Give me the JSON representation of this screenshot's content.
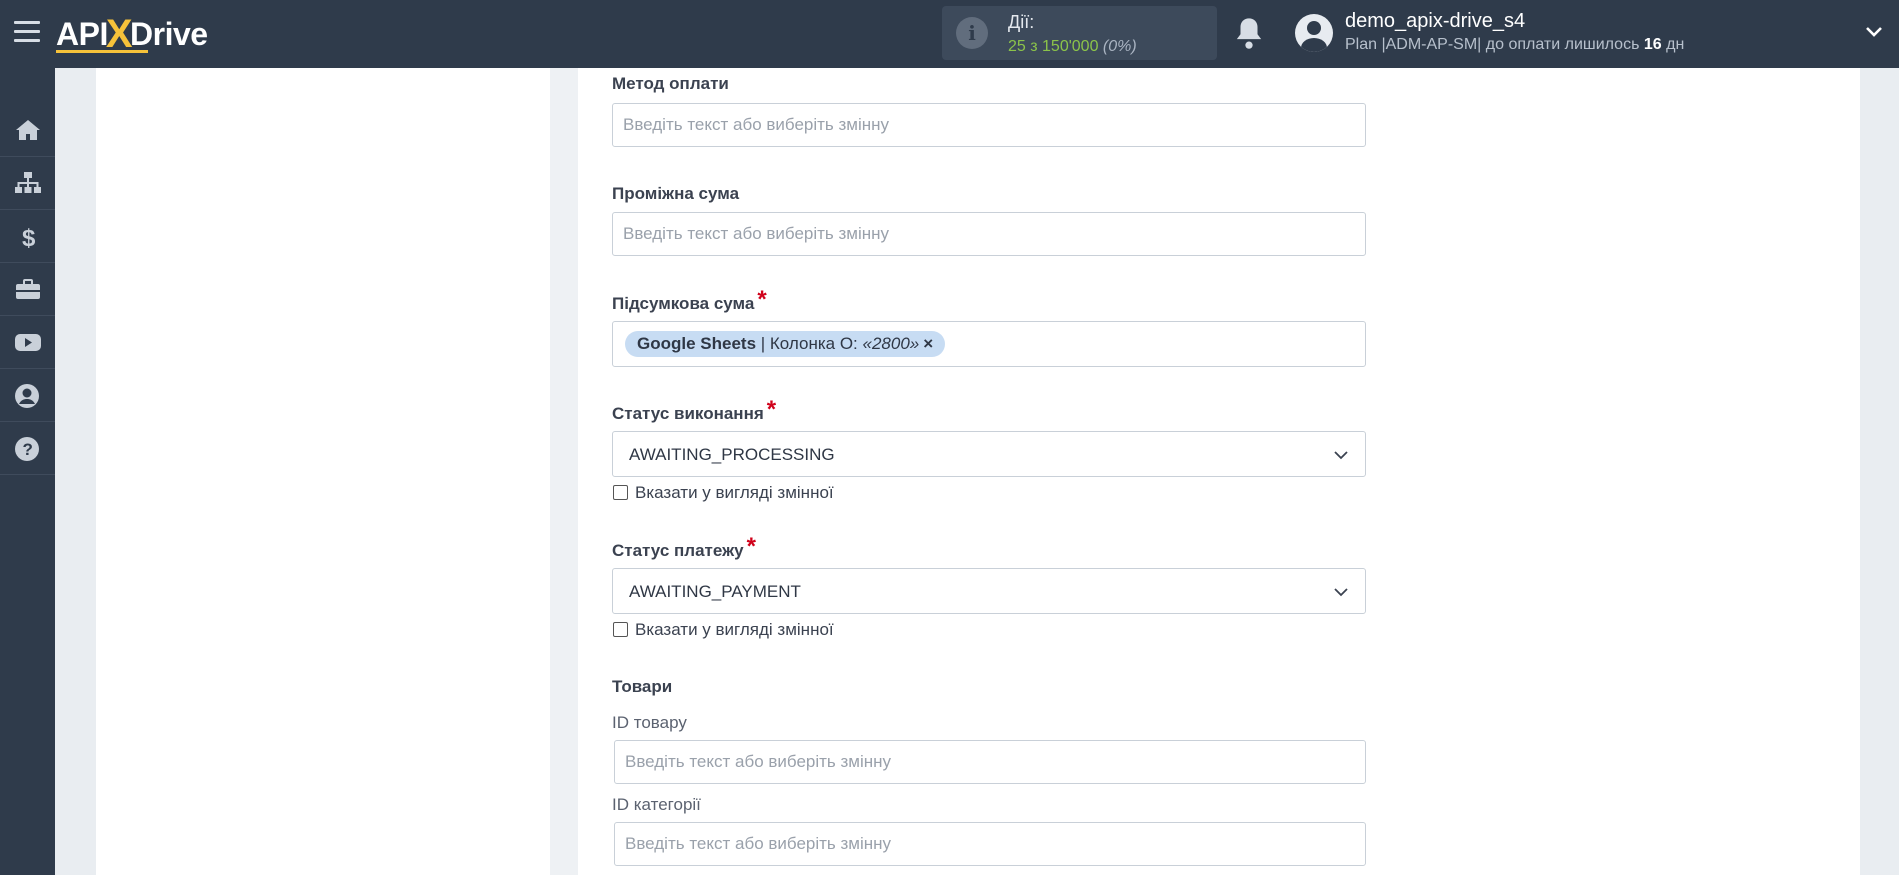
{
  "header": {
    "logo_left": "API",
    "logo_x": "X",
    "logo_right": "Drive",
    "actions_label": "Дії:",
    "actions_count": "25 з 150'000",
    "actions_percent": "(0%)",
    "username": "demo_apix-drive_s4",
    "plan_prefix": "Plan |ADM-AP-SM| до оплати лишилось",
    "plan_days": "16",
    "plan_suffix": "дн"
  },
  "sidebar": {
    "items": [
      {
        "icon": "home-icon"
      },
      {
        "icon": "sitemap-icon"
      },
      {
        "icon": "dollar-icon"
      },
      {
        "icon": "briefcase-icon"
      },
      {
        "icon": "youtube-icon"
      },
      {
        "icon": "user-circle-icon"
      },
      {
        "icon": "help-icon"
      }
    ]
  },
  "form": {
    "placeholder": "Введіть текст або виберіть змінну",
    "payment_method_label": "Метод оплати",
    "subtotal_label": "Проміжна сума",
    "total_label": "Підсумкова сума",
    "total_tag": {
      "source": "Google Sheets",
      "column": " | Колонка O: ",
      "value": "«2800»",
      "remove": "×"
    },
    "exec_status_label": "Статус виконання",
    "exec_status_value": "AWAITING_PROCESSING",
    "exec_status_checkbox": "Вказати у вигляді змінної",
    "payment_status_label": "Статус платежу",
    "payment_status_value": "AWAITING_PAYMENT",
    "payment_status_checkbox": "Вказати у вигляді змінної",
    "products_label": "Товари",
    "product_id_label": "ID товару",
    "category_id_label": "ID категорії",
    "required_mark": "*"
  },
  "colors": {
    "topbar": "#2f3b4b",
    "accent_yellow": "#f6c23a",
    "required_red": "#d0021b",
    "count_green": "#8bc34a"
  }
}
